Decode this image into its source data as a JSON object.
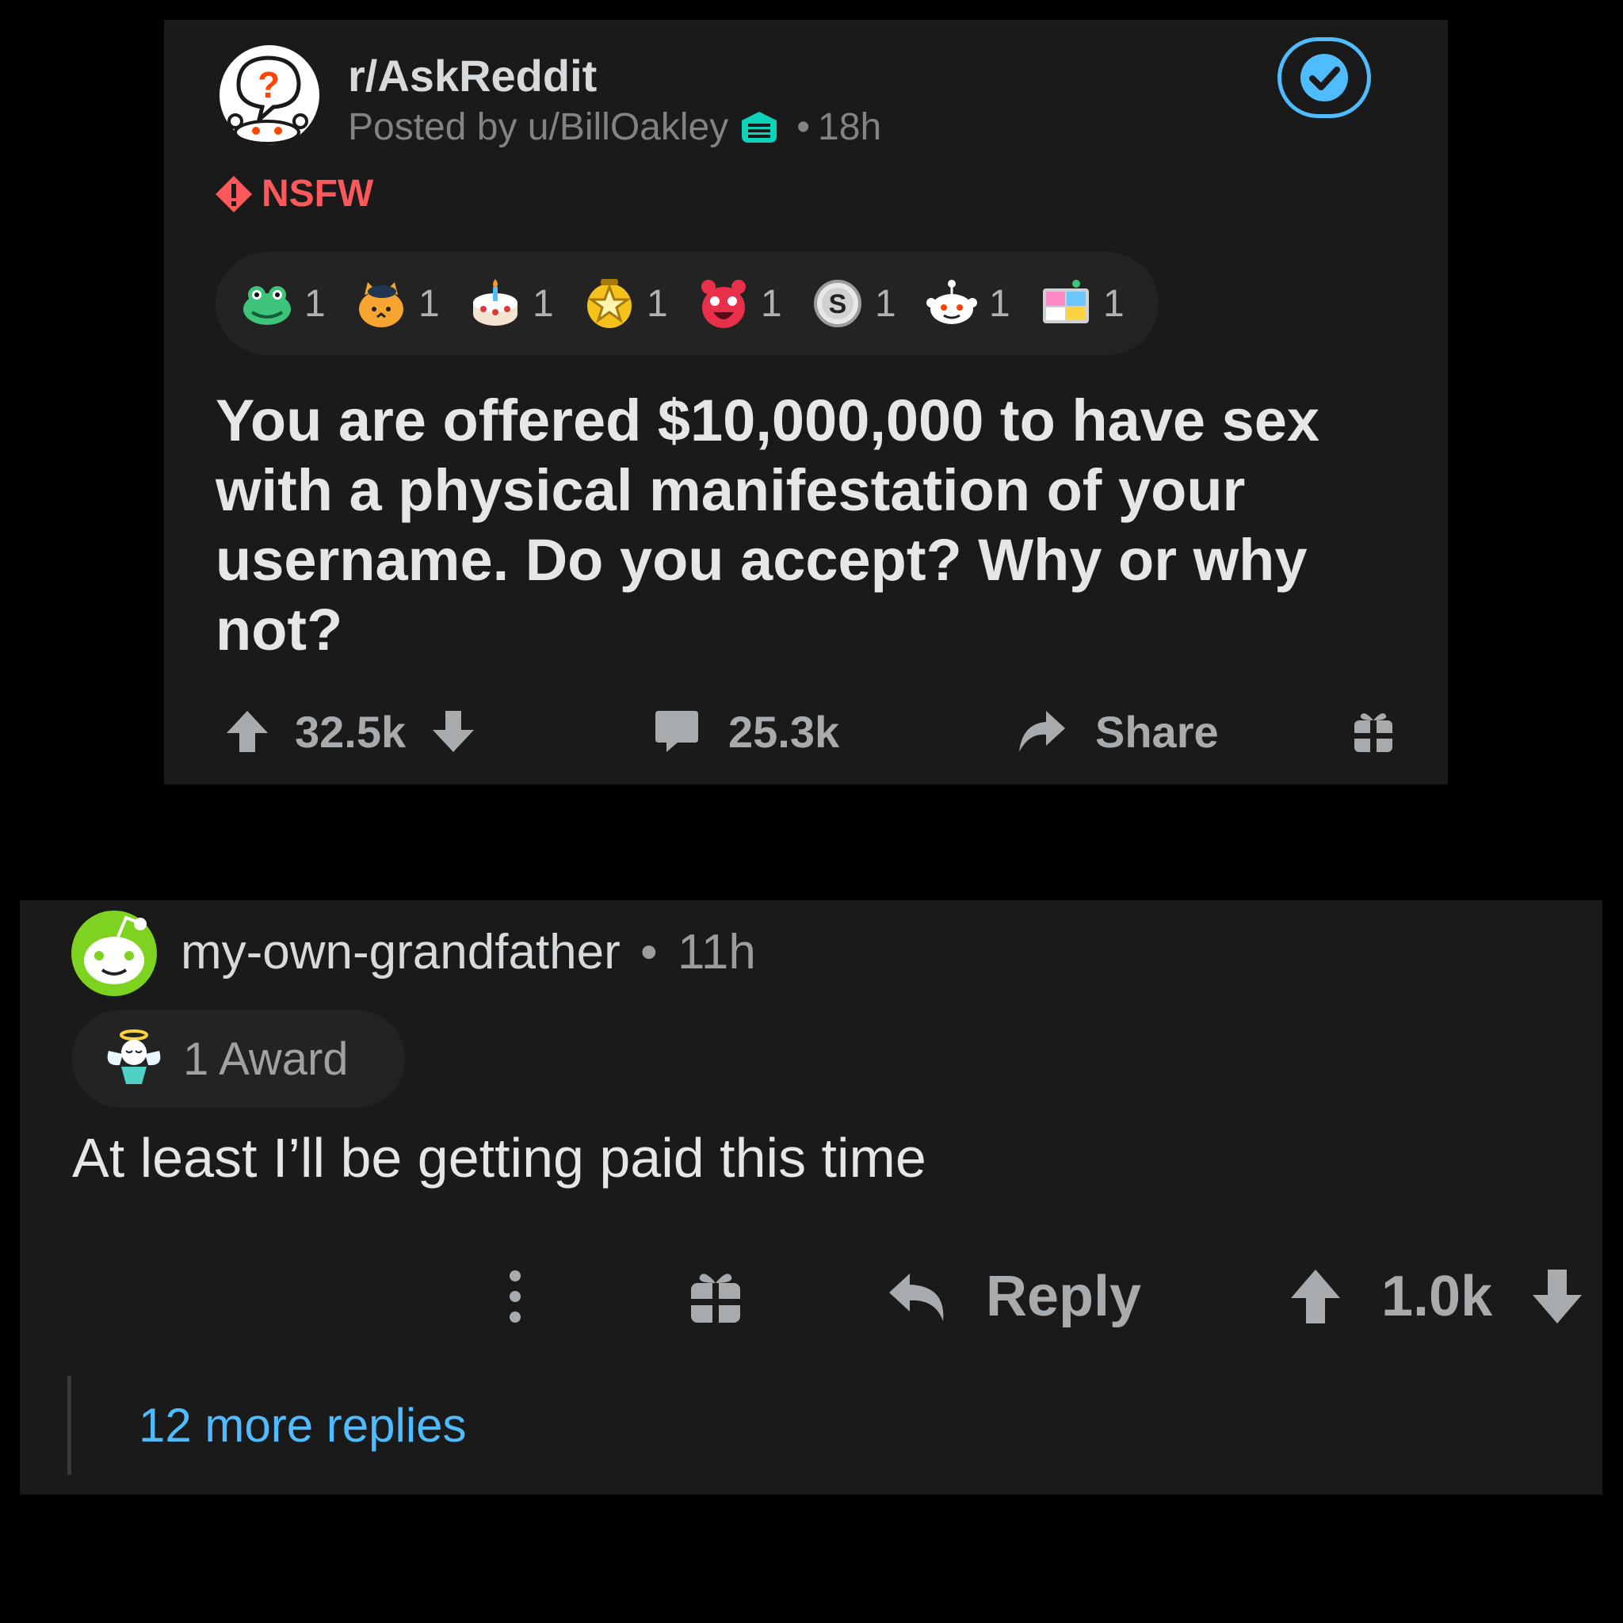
{
  "post": {
    "subreddit": "r/AskReddit",
    "posted_by": "Posted by u/BillOakley",
    "age": "18h",
    "sep": "•",
    "nsfw_label": "NSFW",
    "awards": [
      {
        "icon": "frog-award-icon",
        "count": "1"
      },
      {
        "icon": "orange-cat-award-icon",
        "count": "1"
      },
      {
        "icon": "cake-award-icon",
        "count": "1"
      },
      {
        "icon": "star-award-icon",
        "count": "1"
      },
      {
        "icon": "red-face-award-icon",
        "count": "1"
      },
      {
        "icon": "silver-award-icon",
        "count": "1"
      },
      {
        "icon": "snoo-award-icon",
        "count": "1"
      },
      {
        "icon": "pixel-faces-award-icon",
        "count": "1"
      }
    ],
    "title": "You are offered $10,000,000 to have sex with a physical manifestation of your username. Do you accept? Why or why not?",
    "votes": "32.5k",
    "comments": "25.3k",
    "share_label": "Share"
  },
  "comment": {
    "username": "my-own-grandfather",
    "sep": "•",
    "age": "11h",
    "award_label": "1 Award",
    "body": "At least I’ll be getting paid this time",
    "reply_label": "Reply",
    "votes": "1.0k",
    "more_replies": "12 more replies"
  },
  "colors": {
    "background": "#000000",
    "card": "#1a1a1b",
    "pill": "#232324",
    "nsfw": "#ff585b",
    "link": "#4fbcff",
    "mod_teal": "#0dd3bb"
  }
}
